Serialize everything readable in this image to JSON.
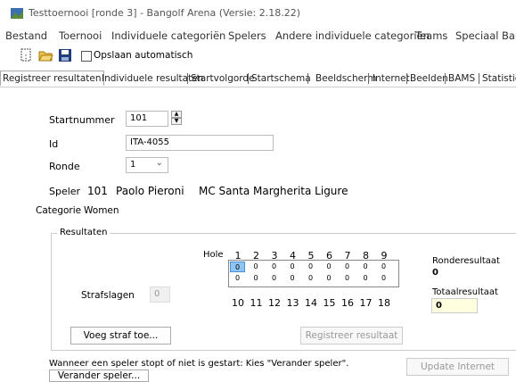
{
  "window": {
    "title": "Testtoernooi [ronde 3] - Bangolf Arena (Versie: 2.18.22)"
  },
  "menu": [
    "Bestand",
    "Toernooi",
    "Individuele categoriën",
    "Spelers",
    "Andere individuele categoriën",
    "Teams",
    "Speciaal",
    "Bangolf"
  ],
  "toolbar": {
    "autosave_label": "Opslaan automatisch",
    "autosave_checked": false
  },
  "tabs": [
    "Registreer resultaten",
    "Individuele resultaten",
    "Startvolgorde",
    "Startschema",
    "Beeldscherm",
    "Internet",
    "Beelden",
    "BAMS",
    "Statistiek"
  ],
  "form": {
    "startnummer_label": "Startnummer",
    "startnummer_value": "101",
    "id_label": "Id",
    "id_value": "ITA-4055",
    "ronde_label": "Ronde",
    "ronde_value": "1",
    "speler_label": "Speler",
    "speler_nr": "101",
    "speler_name": "Paolo Pieroni",
    "speler_club": "MC Santa Margherita Ligure",
    "categorie_label": "Categorie",
    "categorie_value": "Women"
  },
  "results": {
    "group_title": "Resultaten",
    "hole_label": "Hole",
    "holes_top": [
      "1",
      "2",
      "3",
      "4",
      "5",
      "6",
      "7",
      "8",
      "9"
    ],
    "holes_bottom": [
      "10",
      "11",
      "12",
      "13",
      "14",
      "15",
      "16",
      "17",
      "18"
    ],
    "row1": [
      "0",
      "0",
      "0",
      "0",
      "0",
      "0",
      "0",
      "0",
      "0"
    ],
    "row2": [
      "0",
      "0",
      "0",
      "0",
      "0",
      "0",
      "0",
      "0",
      "0"
    ],
    "strafslagen_label": "Strafslagen",
    "strafslagen_value": "0",
    "ronderesultaat_label": "Ronderesultaat",
    "ronderesultaat_value": "0",
    "totaalresultaat_label": "Totaalresultaat",
    "totaalresultaat_value": "0",
    "add_penalty_button": "Voeg straf toe...",
    "register_button": "Registreer resultaat"
  },
  "footer": {
    "hint": "Wanneer een speler stopt of niet is gestart: Kies \"Verander speler\".",
    "change_player_button": "Verander speler...",
    "update_internet_button": "Update Internet"
  }
}
